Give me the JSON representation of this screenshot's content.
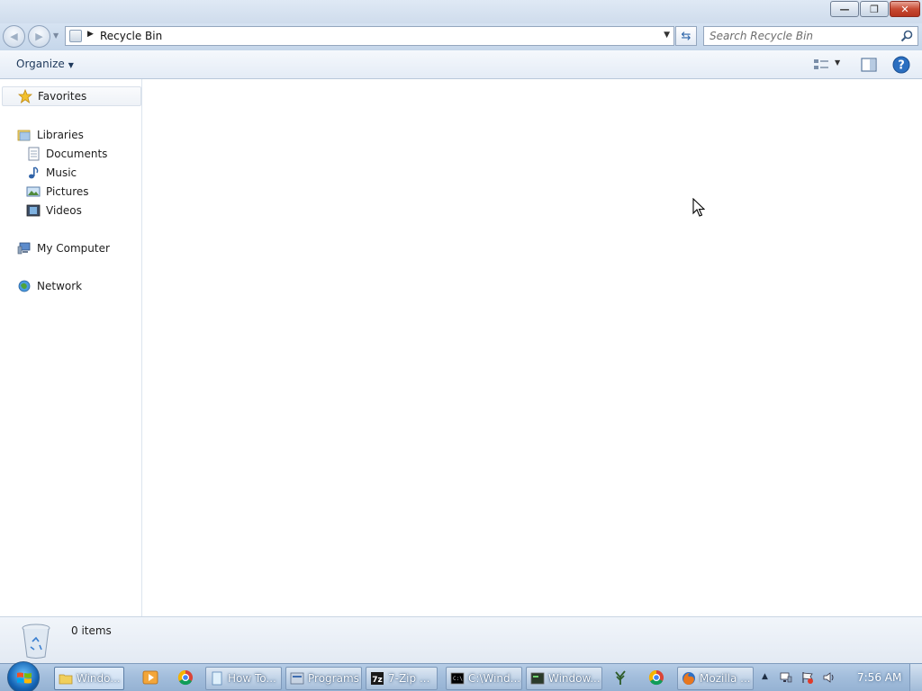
{
  "window": {
    "minimize_glyph": "—",
    "maximize_glyph": "❐",
    "close_glyph": "✕"
  },
  "address": {
    "path": "Recycle Bin",
    "search_placeholder": "Search Recycle Bin"
  },
  "toolbar": {
    "organize_label": "Organize"
  },
  "nav": {
    "favorites": "Favorites",
    "libraries": "Libraries",
    "documents": "Documents",
    "music": "Music",
    "pictures": "Pictures",
    "videos": "Videos",
    "computer": "My Computer",
    "network": "Network"
  },
  "details": {
    "count": "0 items"
  },
  "taskbar": {
    "buttons": [
      {
        "label": "Windo...",
        "icon": "folder-icon"
      },
      {
        "label": "How To...",
        "icon": "document-icon"
      },
      {
        "label": "Programs",
        "icon": "programs-icon"
      },
      {
        "label": "7-Zip ...",
        "icon": "7zip-icon"
      },
      {
        "label": "C:\\Wind...",
        "icon": "cmd-icon"
      },
      {
        "label": "Window...",
        "icon": "terminal-icon"
      },
      {
        "label": "Mozilla ...",
        "icon": "firefox-icon"
      }
    ],
    "clock": "7:56 AM"
  },
  "colors": {
    "accent": "#1e395b",
    "titlebar": "#dfe9f5",
    "taskbar": "#a3bedc",
    "close": "#c74a33"
  }
}
